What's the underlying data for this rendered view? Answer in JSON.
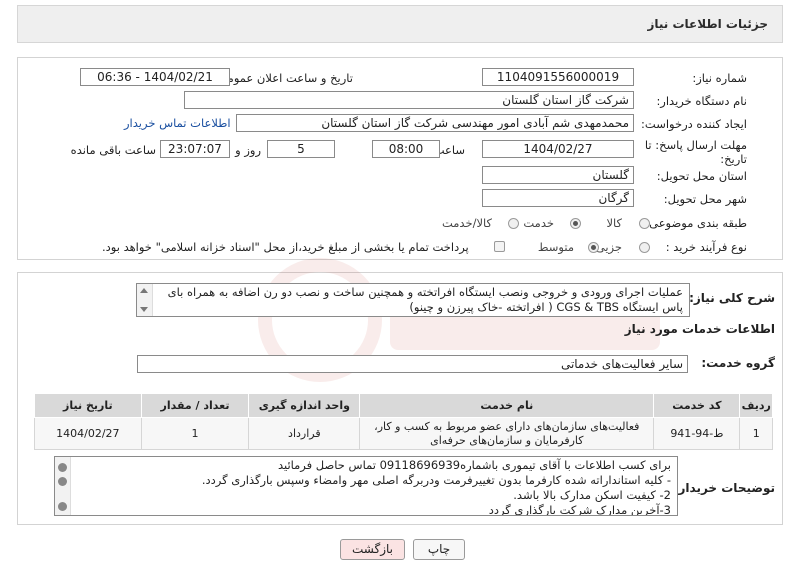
{
  "header": {
    "title": "جزئیات اطلاعات نیاز"
  },
  "fields": {
    "need_number_label": "شماره نیاز:",
    "need_number": "1104091556000019",
    "announce_label": "تاریخ و ساعت اعلان عمومی:",
    "announce_value": "1404/02/21 - 06:36",
    "buyer_label": "نام دستگاه خریدار:",
    "buyer_value": "شرکت گاز استان گلستان",
    "creator_label": "ایجاد کننده درخواست:",
    "creator_value": "محمدمهدی شم آبادی امور مهندسی شرکت گاز استان گلستان",
    "contact_link": "اطلاعات تماس خریدار",
    "deadline_label_1": "مهلت ارسال پاسخ: تا",
    "deadline_label_2": "تاریخ:",
    "deadline_date": "1404/02/27",
    "time_label": "ساعت",
    "deadline_time": "08:00",
    "days_value": "5",
    "days_label": "روز و",
    "remaining_time": "23:07:07",
    "remaining_label": "ساعت باقی مانده",
    "province_label": "استان محل تحویل:",
    "province_value": "گلستان",
    "city_label": "شهر محل تحویل:",
    "city_value": "گرگان",
    "category_label": "طبقه بندی موضوعی:",
    "category_options": [
      "کالا",
      "خدمت",
      "کالا/خدمت"
    ],
    "category_selected": "خدمت",
    "process_label": "نوع فرآیند خرید :",
    "process_options": [
      "جزیی",
      "متوسط"
    ],
    "process_selected": "متوسط",
    "payment_note": "پرداخت تمام یا بخشی از مبلغ خرید،از محل \"اسناد خزانه اسلامی\" خواهد بود."
  },
  "description": {
    "label": "شرح کلی نیاز:",
    "line1": "عملیات اجرای ورودی و خروجی ونصب ایستگاه افراتخته و همچنین ساخت و نصب دو رن اضافه به همراه بای",
    "line2": "پاس ایستگاه CGS & TBS  ( افراتخته -خاک پیرزن و چینو)"
  },
  "services": {
    "section_title": "اطلاعات خدمات مورد نیاز",
    "group_label": "گروه خدمت:",
    "group_value": "سایر فعالیت‌های خدماتی",
    "columns": [
      "ردیف",
      "کد خدمت",
      "نام خدمت",
      "واحد اندازه گیری",
      "تعداد / مقدار",
      "تاریخ نیاز"
    ],
    "rows": [
      {
        "index": "1",
        "code": "ط-94-941",
        "name_line1": "فعالیت‌های سازمان‌های دارای عضو مربوط به کسب و کار،",
        "name_line2": "کارفرمایان و سازمان‌های حرفه‌ای",
        "unit": "قرارداد",
        "qty": "1",
        "date": "1404/02/27"
      }
    ]
  },
  "buyer_notes": {
    "label": "توضیحات خریدار:",
    "lines": [
      "برای کسب اطلاعات با آقای تیموری باشماره09118696939 تماس حاصل فرمائید",
      "-      کلیه استانداراته شده کارفرما بدون تغییرفرمت ودربرگه اصلی مهر وامضاء وسپس بارگذاری گردد.",
      "2-    کیفیت اسکن مدارک بالا  باشد.",
      "3-آخرین مدارک شرکت بارگذاری گردد"
    ]
  },
  "buttons": {
    "print": "چاپ",
    "back": "بازگشت"
  },
  "colors": {
    "back_button_bg": "#fbe3e3",
    "link": "#1a4fa0",
    "header_bg": "#efefef"
  }
}
